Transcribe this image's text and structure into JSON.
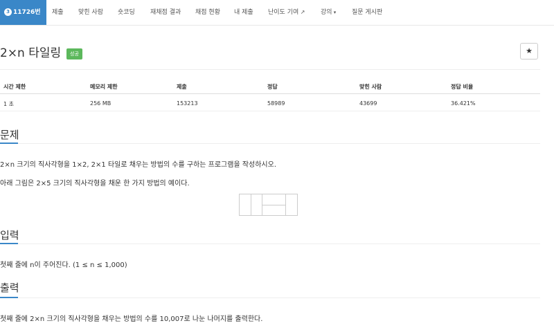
{
  "nav": {
    "problem_badge": "3",
    "problem_label": "11726번",
    "items": [
      "제출",
      "맞힌 사람",
      "숏코딩",
      "재채점 결과",
      "채점 현황",
      "내 제출",
      "난이도 기여",
      "강의",
      "질문 게시판"
    ]
  },
  "problem": {
    "title": "2×n 타일링",
    "status_badge": "성공",
    "star_icon": "★"
  },
  "stats": {
    "headers": [
      "시간 제한",
      "메모리 제한",
      "제출",
      "정답",
      "맞힌 사람",
      "정답 비율"
    ],
    "values": [
      "1 초",
      "256 MB",
      "153213",
      "58989",
      "43699",
      "36.421%"
    ]
  },
  "sections": {
    "problem": {
      "heading": "문제",
      "para1": "2×n 크기의 직사각형을 1×2, 2×1 타일로 채우는 방법의 수를 구하는 프로그램을 작성하시오.",
      "para2": "아래 그림은 2×5 크기의 직사각형을 채운 한 가지 방법의 예이다."
    },
    "input": {
      "heading": "입력",
      "text": "첫째 줄에 n이 주어진다. (1 ≤ n ≤ 1,000)"
    },
    "output": {
      "heading": "출력",
      "text": "첫째 줄에 2×n 크기의 직사각형을 채우는 방법의 수를 10,007로 나눈 나머지를 출력한다."
    }
  },
  "colors": {
    "accent": "#3a87c8",
    "success": "#5cb85c"
  }
}
